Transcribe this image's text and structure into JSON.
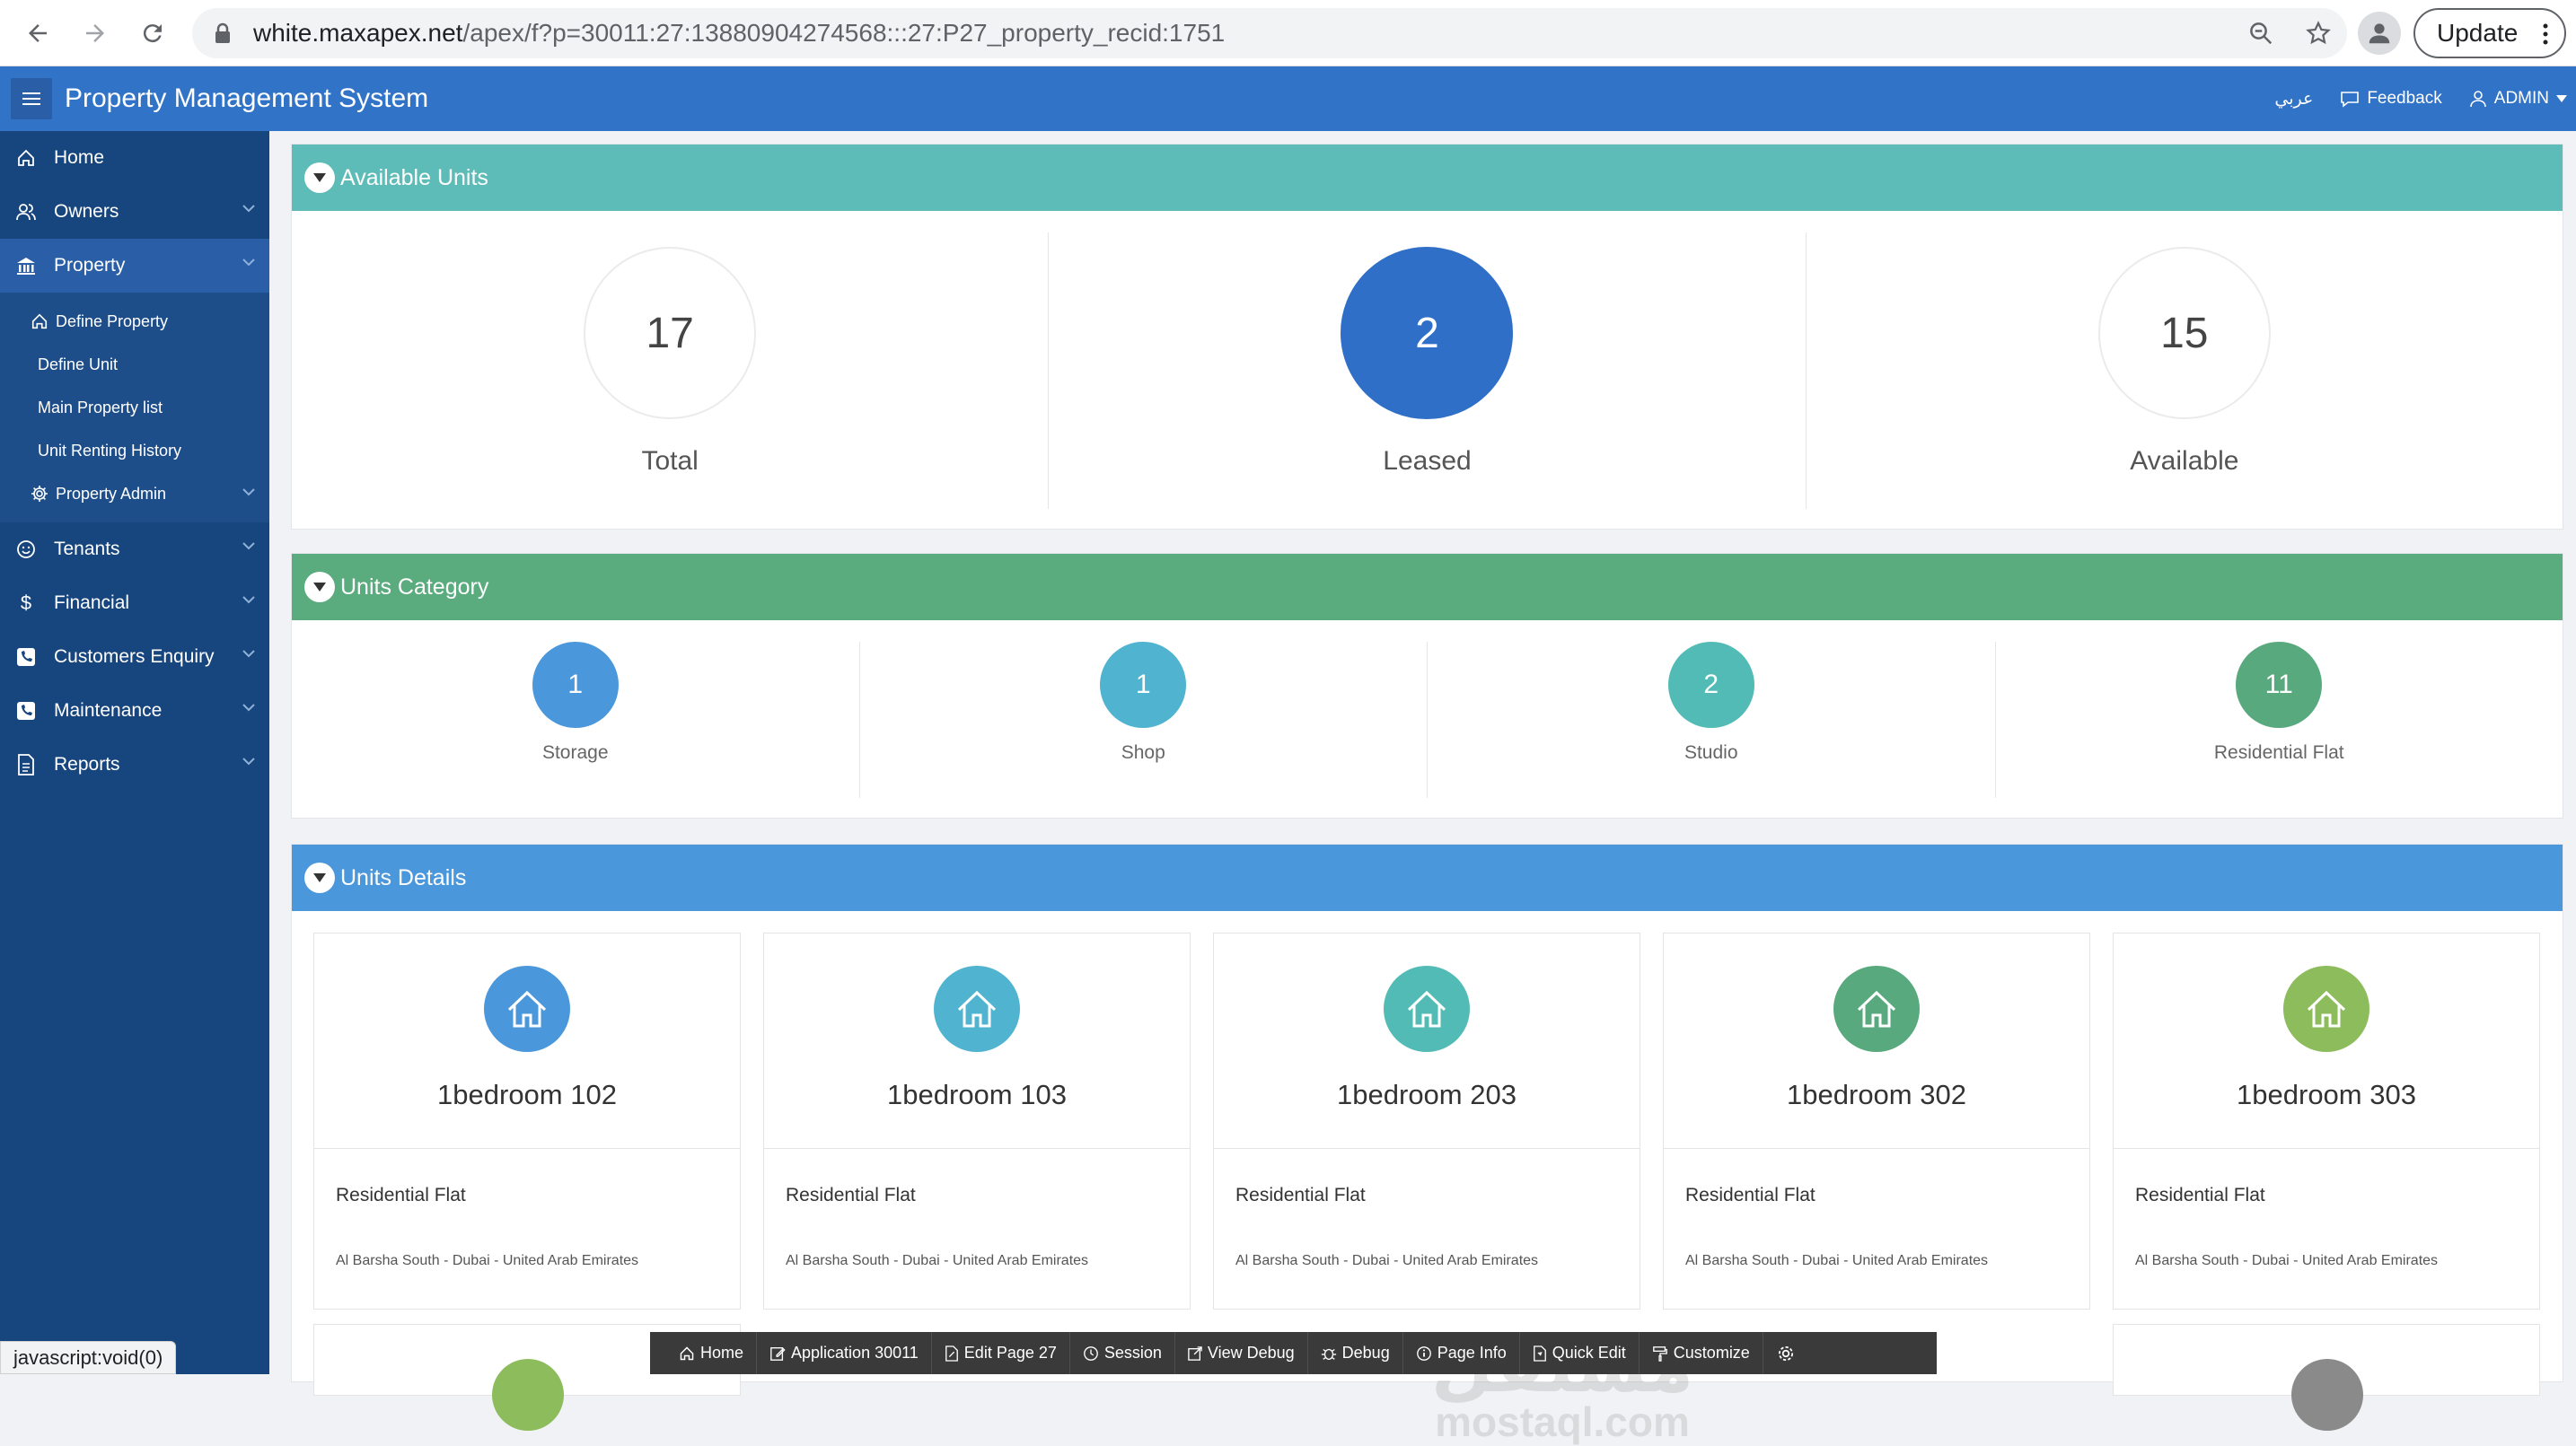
{
  "browser": {
    "url_host": "white.maxapex.net",
    "url_path": "/apex/f?p=30011:27:13880904274568:::27:P27_property_recid:1751",
    "update_label": "Update",
    "status_text": "javascript:void(0)"
  },
  "header": {
    "title": "Property Management System",
    "lang_label": "عربي",
    "feedback_label": "Feedback",
    "user_label": "ADMIN"
  },
  "sidebar": {
    "items": [
      {
        "label": "Home",
        "icon": "home-icon"
      },
      {
        "label": "Owners",
        "icon": "users-icon"
      },
      {
        "label": "Property",
        "icon": "bank-icon"
      },
      {
        "label": "Tenants",
        "icon": "smile-icon"
      },
      {
        "label": "Financial",
        "icon": "dollar-icon"
      },
      {
        "label": "Customers Enquiry",
        "icon": "phone-icon"
      },
      {
        "label": "Maintenance",
        "icon": "phone-icon"
      },
      {
        "label": "Reports",
        "icon": "document-icon"
      }
    ],
    "property_sub": [
      {
        "label": "Define Property"
      },
      {
        "label": "Define Unit"
      },
      {
        "label": "Main Property list"
      },
      {
        "label": "Unit Renting History"
      },
      {
        "label": "Property Admin"
      }
    ]
  },
  "available_units": {
    "title": "Available Units",
    "badges": [
      {
        "value": "17",
        "label": "Total"
      },
      {
        "value": "2",
        "label": "Leased"
      },
      {
        "value": "15",
        "label": "Available"
      }
    ]
  },
  "units_category": {
    "title": "Units Category",
    "items": [
      {
        "value": "1",
        "label": "Storage",
        "color": "#4b97db"
      },
      {
        "value": "1",
        "label": "Shop",
        "color": "#50b3cf"
      },
      {
        "value": "2",
        "label": "Studio",
        "color": "#52bbb6"
      },
      {
        "value": "11",
        "label": "Residential Flat",
        "color": "#58a97e"
      }
    ]
  },
  "units_details": {
    "title": "Units Details",
    "cards": [
      {
        "title": "1bedroom 102",
        "type": "Residential Flat",
        "location": "Al Barsha South - Dubai - United Arab Emirates",
        "color": "#4b97db"
      },
      {
        "title": "1bedroom 103",
        "type": "Residential Flat",
        "location": "Al Barsha South - Dubai - United Arab Emirates",
        "color": "#50b3cf"
      },
      {
        "title": "1bedroom 203",
        "type": "Residential Flat",
        "location": "Al Barsha South - Dubai - United Arab Emirates",
        "color": "#52bbb6"
      },
      {
        "title": "1bedroom 302",
        "type": "Residential Flat",
        "location": "Al Barsha South - Dubai - United Arab Emirates",
        "color": "#58a97e"
      },
      {
        "title": "1bedroom 303",
        "type": "Residential Flat",
        "location": "Al Barsha South - Dubai - United Arab Emirates",
        "color": "#8cbc5c"
      }
    ]
  },
  "dev_toolbar": {
    "items": [
      {
        "label": "Home",
        "icon": "home-icon"
      },
      {
        "label": "Application 30011",
        "icon": "edit-icon"
      },
      {
        "label": "Edit Page 27",
        "icon": "edit-page-icon"
      },
      {
        "label": "Session",
        "icon": "clock-icon"
      },
      {
        "label": "View Debug",
        "icon": "external-icon"
      },
      {
        "label": "Debug",
        "icon": "bug-icon"
      },
      {
        "label": "Page Info",
        "icon": "info-icon"
      },
      {
        "label": "Quick Edit",
        "icon": "quick-edit-icon"
      },
      {
        "label": "Customize",
        "icon": "brush-icon"
      }
    ]
  },
  "watermark": {
    "line1": "مستقل",
    "line2": "mostaql.com"
  }
}
